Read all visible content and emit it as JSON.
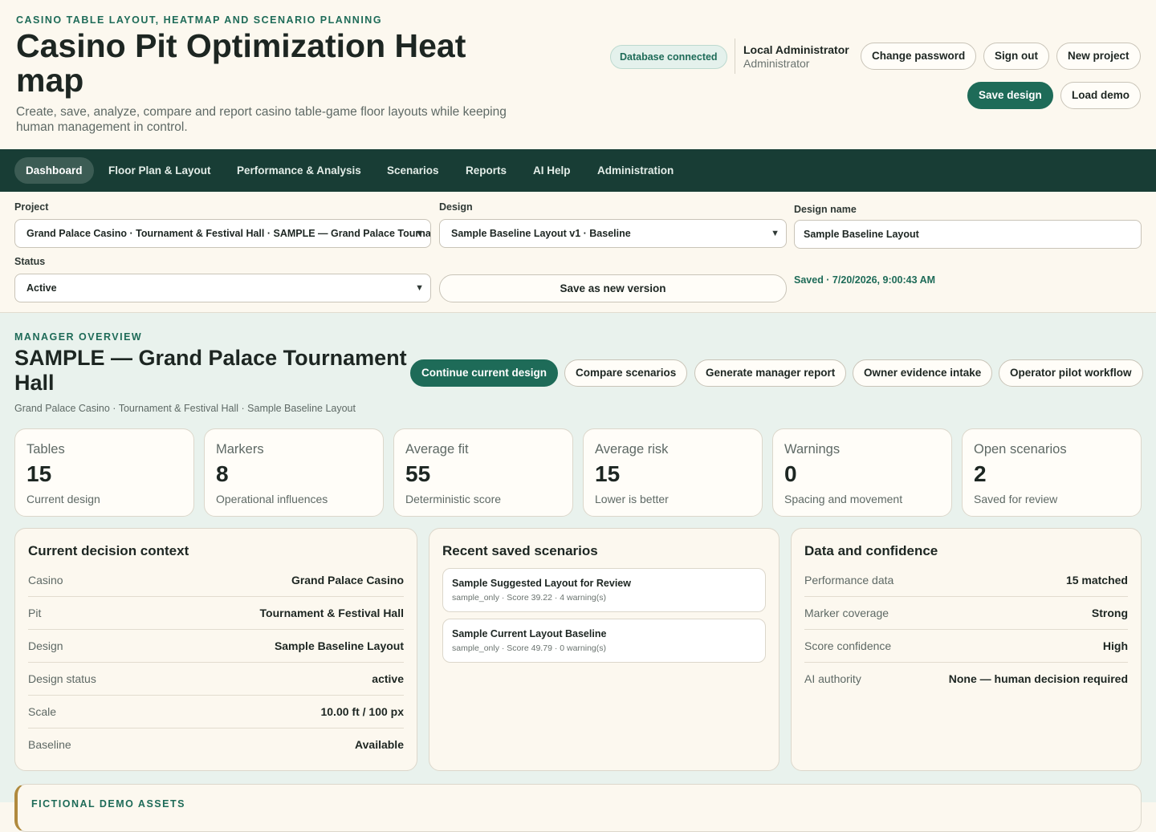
{
  "header": {
    "eyebrow": "CASINO TABLE LAYOUT, HEATMAP AND SCENARIO PLANNING",
    "title": "Casino Pit Optimization Heat map",
    "subtitle": "Create, save, analyze, compare and report casino table-game floor layouts while keeping human management in control.",
    "db_status": "Database connected",
    "user_name": "Local Administrator",
    "user_role": "Administrator",
    "buttons": {
      "change_password": "Change password",
      "sign_out": "Sign out",
      "new_project": "New project",
      "save_design": "Save design",
      "load_demo": "Load demo"
    }
  },
  "nav": {
    "items": [
      {
        "label": "Dashboard",
        "active": true
      },
      {
        "label": "Floor Plan & Layout"
      },
      {
        "label": "Performance & Analysis"
      },
      {
        "label": "Scenarios"
      },
      {
        "label": "Reports"
      },
      {
        "label": "AI Help"
      },
      {
        "label": "Administration"
      }
    ]
  },
  "form": {
    "project_label": "Project",
    "project_value": "Grand Palace Casino · Tournament & Festival Hall · SAMPLE — Grand Palace Tournament Hall",
    "design_label": "Design",
    "design_value": "Sample Baseline Layout v1 · Baseline",
    "design_name_label": "Design name",
    "design_name_value": "Sample Baseline Layout",
    "status_label": "Status",
    "status_value": "Active",
    "save_version": "Save as new version",
    "saved_note": "Saved · 7/20/2026, 9:00:43 AM"
  },
  "overview": {
    "eyebrow": "MANAGER OVERVIEW",
    "title": "SAMPLE — Grand Palace Tournament Hall",
    "subtitle": "Grand Palace Casino · Tournament & Festival Hall · Sample Baseline Layout",
    "actions": {
      "continue": "Continue current design",
      "compare": "Compare scenarios",
      "report": "Generate manager report",
      "evidence": "Owner evidence intake",
      "pilot": "Operator pilot workflow"
    },
    "stats": [
      {
        "label": "Tables",
        "value": "15",
        "note": "Current design"
      },
      {
        "label": "Markers",
        "value": "8",
        "note": "Operational influences"
      },
      {
        "label": "Average fit",
        "value": "55",
        "note": "Deterministic score"
      },
      {
        "label": "Average risk",
        "value": "15",
        "note": "Lower is better"
      },
      {
        "label": "Warnings",
        "value": "0",
        "note": "Spacing and movement"
      },
      {
        "label": "Open scenarios",
        "value": "2",
        "note": "Saved for review"
      }
    ],
    "context": {
      "title": "Current decision context",
      "rows": [
        {
          "k": "Casino",
          "v": "Grand Palace Casino"
        },
        {
          "k": "Pit",
          "v": "Tournament & Festival Hall"
        },
        {
          "k": "Design",
          "v": "Sample Baseline Layout"
        },
        {
          "k": "Design status",
          "v": "active"
        },
        {
          "k": "Scale",
          "v": "10.00 ft / 100 px"
        },
        {
          "k": "Baseline",
          "v": "Available"
        }
      ]
    },
    "scenarios": {
      "title": "Recent saved scenarios",
      "items": [
        {
          "title": "Sample Suggested Layout for Review",
          "meta": "sample_only · Score 39.22 · 4 warning(s)"
        },
        {
          "title": "Sample Current Layout Baseline",
          "meta": "sample_only · Score 49.79 · 0 warning(s)"
        }
      ]
    },
    "confidence": {
      "title": "Data and confidence",
      "rows": [
        {
          "k": "Performance data",
          "v": "15 matched"
        },
        {
          "k": "Marker coverage",
          "v": "Strong"
        },
        {
          "k": "Score confidence",
          "v": "High"
        },
        {
          "k": "AI authority",
          "v": "None — human decision required"
        }
      ]
    },
    "assets_label": "FICTIONAL DEMO ASSETS"
  },
  "colors": {
    "brand": "#1e6b58",
    "nav_bg": "#183d35",
    "page_bg": "#fcf8ef",
    "overview_bg": "#e9f2ed",
    "accent_gold": "#b08a3e"
  }
}
